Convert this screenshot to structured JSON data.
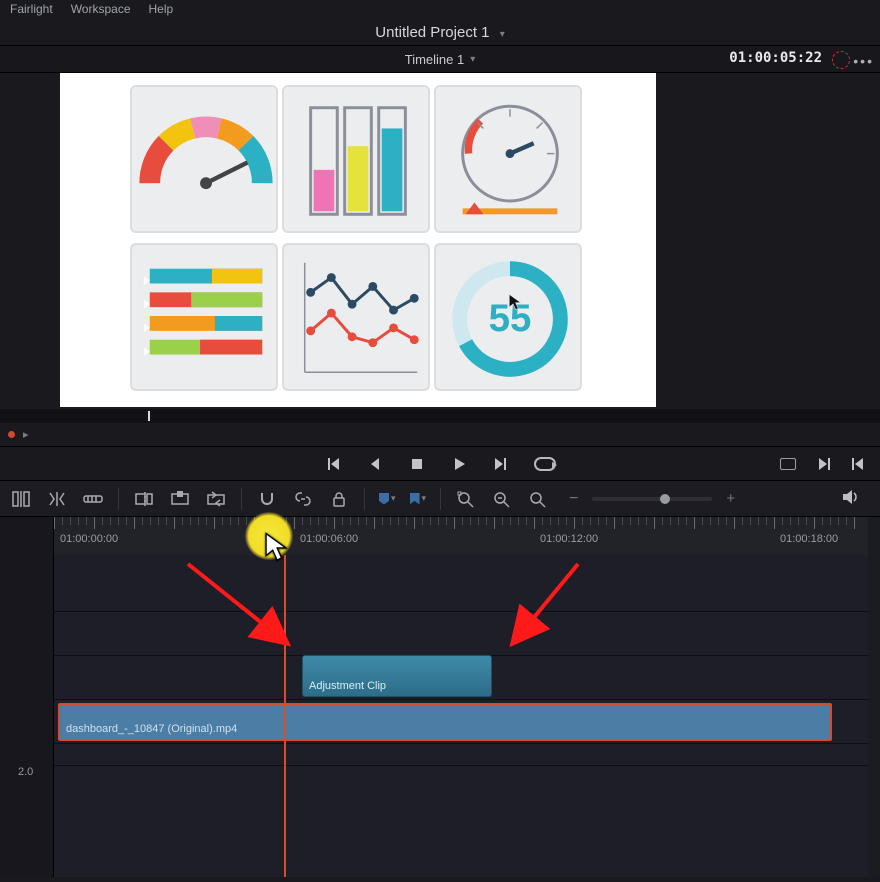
{
  "menu": {
    "fairlight": "Fairlight",
    "workspace": "Workspace",
    "help": "Help"
  },
  "project": {
    "title": "Untitled Project 1"
  },
  "timeline_sel": {
    "name": "Timeline 1"
  },
  "timecode": "01:00:05:22",
  "ruler": {
    "labels": [
      "01:00:00:00",
      "01:00:06:00",
      "01:00:12:00",
      "01:00:18:00"
    ]
  },
  "clips": {
    "adjustment": "Adjustment Clip",
    "video": "dashboard_-_10847 (Original).mp4"
  },
  "track_label": "2.0",
  "viewer_gauge_value": "55",
  "zoom": {
    "minus": "−",
    "plus": "+"
  },
  "icons": {
    "skip_start": "skip-start-icon",
    "step_back": "step-back-icon",
    "stop": "stop-icon",
    "play": "play-icon",
    "skip_end": "skip-end-icon",
    "loop": "loop-icon",
    "selection": "selection-tool-icon",
    "trim": "trim-tool-icon",
    "razor": "dynamic-trim-icon",
    "insert": "insert-clip-icon",
    "overwrite": "overwrite-clip-icon",
    "replace": "replace-clip-icon",
    "snap": "snap-icon",
    "link": "link-icon",
    "lock": "lock-icon",
    "flag": "flag-icon",
    "marker": "marker-icon",
    "search_full": "full-extent-icon",
    "search_detail": "detail-zoom-icon",
    "search_custom": "custom-zoom-icon",
    "vol": "volume-icon"
  }
}
